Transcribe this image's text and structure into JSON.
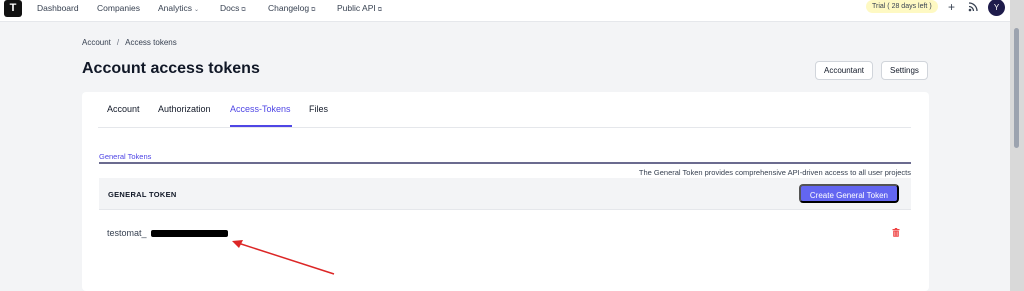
{
  "nav": {
    "logo": "T",
    "items": [
      {
        "label": "Dashboard",
        "ext": ""
      },
      {
        "label": "Companies",
        "ext": ""
      },
      {
        "label": "Analytics",
        "ext": "⌄"
      },
      {
        "label": "Docs",
        "ext": "⧉"
      },
      {
        "label": "Changelog",
        "ext": "⧉"
      },
      {
        "label": "Public API",
        "ext": "⧉"
      }
    ],
    "trial": "Trial ( 28 days left )",
    "plus": "+",
    "avatar": "Y"
  },
  "breadcrumb": {
    "root": "Account",
    "sep": "/",
    "current": "Access tokens"
  },
  "page": {
    "title": "Account access tokens",
    "btn_accountant": "Accountant",
    "btn_settings": "Settings"
  },
  "tabs": [
    "Account",
    "Authorization",
    "Access-Tokens",
    "Files"
  ],
  "general": {
    "section_label": "General Tokens",
    "description": "The General Token provides comprehensive API-driven access to all user projects",
    "column_header": "GENERAL TOKEN",
    "create_button": "Create General Token",
    "token_prefix": "testomat_"
  },
  "colors": {
    "accent": "#4f46e5",
    "button": "#6366f1",
    "danger": "#ef4444",
    "annotation": "#dc2626",
    "trial_bg": "#fef9c3"
  },
  "icons": [
    "logo-icon",
    "external-link-icon",
    "chevron-down-icon",
    "plus-icon",
    "rss-icon",
    "trash-icon"
  ]
}
